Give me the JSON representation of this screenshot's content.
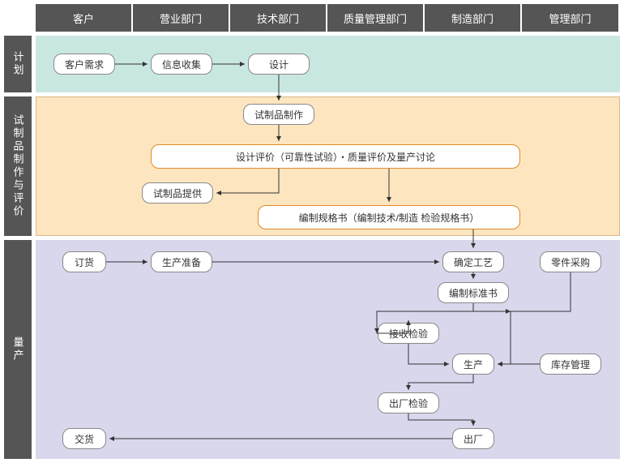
{
  "columns": {
    "c1": "客户",
    "c2": "营业部门",
    "c3": "技术部门",
    "c4": "质量管理部门",
    "c5": "制造部门",
    "c6": "管理部门"
  },
  "rows": {
    "r1": "计划",
    "r2": "试制品制作与评价",
    "r3": "量产"
  },
  "nodes": {
    "need": "客户需求",
    "collect": "信息收集",
    "design": "设计",
    "proto_make": "试制品制作",
    "eval": "设计评价（可靠性试验）・质量评价及量产讨论",
    "proto_give": "试制品提供",
    "spec": "编制规格书（编制技术/制造 检验规格书）",
    "order": "订货",
    "prep": "生产准备",
    "process": "确定工艺",
    "parts": "零件采购",
    "std": "编制标准书",
    "receive": "接收检验",
    "produce": "生产",
    "stock": "库存管理",
    "outinsp": "出厂检验",
    "ship": "出厂",
    "deliver": "交货"
  }
}
